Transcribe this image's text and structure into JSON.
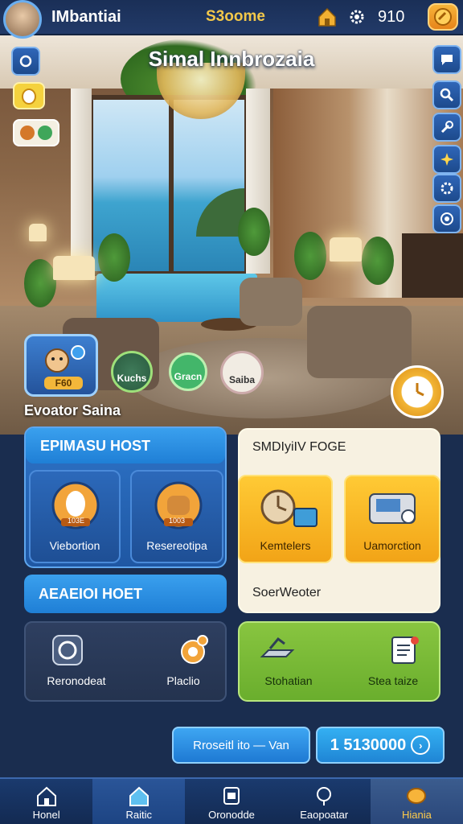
{
  "header": {
    "player_name": "IMbantiai",
    "score_label": "S3oome",
    "coins": "910"
  },
  "scene": {
    "title": "Simal Innbrozaia",
    "subtitle": "Evoator Saina"
  },
  "bubbles": {
    "main_coin": "F60",
    "b1_label": "Kuchs",
    "b2_label": "Gracn",
    "b3_label": "Saiba"
  },
  "panel_left": {
    "head1": "EPIMASU HOST",
    "tile1": "Viebortion",
    "tile1_badge": "103E",
    "tile2": "Resereotipa",
    "tile2_badge": "1003",
    "head2": "AEAEIOI HOET",
    "tile3": "Reronodeat",
    "tile4": "Placlio"
  },
  "panel_right": {
    "head1": "SMDIyiIV FOGE",
    "tile1": "Kemtelers",
    "tile2": "Uamorction",
    "head2": "SoerWeoter",
    "tile3": "Stohatian",
    "tile4": "Stea taize"
  },
  "buttons": {
    "btn_a": "Rroseitl ito — Van",
    "btn_b": "1 5130000"
  },
  "nav": [
    {
      "label": "Honel"
    },
    {
      "label": "Raitic"
    },
    {
      "label": "Oronodde"
    },
    {
      "label": "Eaopoatar"
    },
    {
      "label": "Hiania"
    }
  ],
  "colors": {
    "primary_blue": "#1f57a3",
    "accent_yellow": "#f2a417",
    "accent_green": "#6aae2d",
    "nav_bg": "#132a52"
  }
}
